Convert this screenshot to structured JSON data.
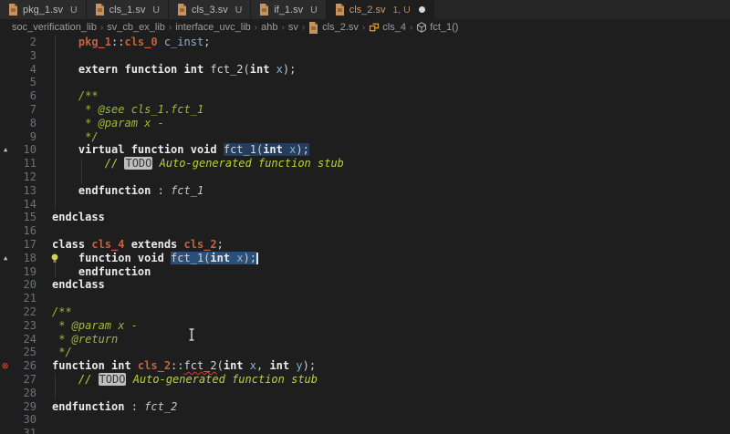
{
  "colors": {
    "editor_bg": "#1E1E1E",
    "active_tab_label": "#D79A63",
    "selection": "#2A4F78",
    "keyword": "#EAEAEA",
    "type_name": "#C4623F",
    "variable": "#8FB0D1",
    "comment": "#9FB83A",
    "error": "#CE4A33",
    "todo_bg": "#BFBFBF"
  },
  "tabs": [
    {
      "label": "pkg_1.sv",
      "suffix": "U",
      "active": false,
      "dirty": false
    },
    {
      "label": "cls_1.sv",
      "suffix": "U",
      "active": false,
      "dirty": false
    },
    {
      "label": "cls_3.sv",
      "suffix": "U",
      "active": false,
      "dirty": false
    },
    {
      "label": "if_1.sv",
      "suffix": "U",
      "active": false,
      "dirty": false
    },
    {
      "label": "cls_2.sv",
      "suffix": "1, U",
      "active": true,
      "dirty": true
    }
  ],
  "breadcrumb": {
    "items": [
      {
        "label": "soc_verification_lib"
      },
      {
        "label": "sv_cb_ex_lib"
      },
      {
        "label": "interface_uvc_lib"
      },
      {
        "label": "ahb"
      },
      {
        "label": "sv"
      },
      {
        "label": "cls_2.sv",
        "icon": "file"
      },
      {
        "label": "cls_4",
        "icon": "class"
      },
      {
        "label": "fct_1()",
        "icon": "method"
      }
    ]
  },
  "editor": {
    "lines": [
      {
        "n": 2,
        "g": 1,
        "t": [
          {
            "c": "ty",
            "x": "    pkg_1"
          },
          {
            "c": "pu",
            "x": "::"
          },
          {
            "c": "ty",
            "x": "cls_0"
          },
          {
            "c": "va",
            "x": " c_inst"
          },
          {
            "c": "pu",
            "x": ";"
          }
        ]
      },
      {
        "n": 3,
        "g": 1,
        "t": []
      },
      {
        "n": 4,
        "g": 1,
        "t": [
          {
            "c": "kw",
            "x": "    extern function int"
          },
          {
            "c": "id",
            "x": " fct_2"
          },
          {
            "c": "pu",
            "x": "("
          },
          {
            "c": "kw",
            "x": "int"
          },
          {
            "c": "va",
            "x": " x"
          },
          {
            "c": "pu",
            "x": ");"
          }
        ]
      },
      {
        "n": 5,
        "g": 1,
        "t": []
      },
      {
        "n": 6,
        "g": 1,
        "t": [
          {
            "c": "dc",
            "x": "    /**"
          }
        ]
      },
      {
        "n": 7,
        "g": 1,
        "t": [
          {
            "c": "dc",
            "x": "     * @see cls_1.fct_1"
          }
        ]
      },
      {
        "n": 8,
        "g": 1,
        "t": [
          {
            "c": "dc",
            "x": "     * @param x -"
          }
        ]
      },
      {
        "n": 9,
        "g": 1,
        "t": [
          {
            "c": "dc",
            "x": "     */"
          }
        ]
      },
      {
        "n": 10,
        "g": 1,
        "marker": "triangle",
        "t": [
          {
            "c": "kw",
            "x": "    virtual function void "
          },
          {
            "c": "se2",
            "t": [
              {
                "c": "id",
                "x": "fct_1"
              },
              {
                "c": "pu",
                "x": "("
              },
              {
                "c": "kw",
                "x": "int"
              },
              {
                "c": "va",
                "x": " x"
              },
              {
                "c": "pu",
                "x": ");"
              }
            ]
          }
        ]
      },
      {
        "n": 11,
        "g": 2,
        "t": [
          {
            "c": "cm",
            "x": "        // "
          },
          {
            "c": "td",
            "x": "TODO"
          },
          {
            "c": "cm",
            "x": " Auto-generated function stub"
          }
        ]
      },
      {
        "n": 12,
        "g": 2,
        "t": []
      },
      {
        "n": 13,
        "g": 1,
        "t": [
          {
            "c": "kw",
            "x": "    endfunction"
          },
          {
            "c": "pu",
            "x": " : "
          },
          {
            "c": "ii",
            "x": "fct_1"
          }
        ]
      },
      {
        "n": 14,
        "g": 1,
        "t": []
      },
      {
        "n": 15,
        "t": [
          {
            "c": "kw",
            "x": "endclass"
          }
        ]
      },
      {
        "n": 16,
        "t": []
      },
      {
        "n": 17,
        "t": [
          {
            "c": "kw",
            "x": "class "
          },
          {
            "c": "ty",
            "x": "cls_4"
          },
          {
            "c": "kw",
            "x": " extends "
          },
          {
            "c": "ty",
            "x": "cls_2"
          },
          {
            "c": "pu",
            "x": ";"
          }
        ]
      },
      {
        "n": 18,
        "g": 1,
        "marker": "triangle",
        "bulb": true,
        "t": [
          {
            "c": "kw",
            "x": "    function void "
          },
          {
            "c": "se",
            "t": [
              {
                "c": "id",
                "x": "fct_1"
              },
              {
                "c": "pu",
                "x": "("
              },
              {
                "c": "kw",
                "x": "int"
              },
              {
                "c": "va",
                "x": " x"
              },
              {
                "c": "pu",
                "x": ");"
              }
            ]
          },
          {
            "c": "ca"
          }
        ]
      },
      {
        "n": 19,
        "g": 1,
        "t": [
          {
            "c": "kw",
            "x": "    endfunction"
          }
        ]
      },
      {
        "n": 20,
        "t": [
          {
            "c": "kw",
            "x": "endclass"
          }
        ]
      },
      {
        "n": 21,
        "t": []
      },
      {
        "n": 22,
        "t": [
          {
            "c": "dc",
            "x": "/**"
          }
        ]
      },
      {
        "n": 23,
        "t": [
          {
            "c": "dc",
            "x": " * @param x -"
          }
        ]
      },
      {
        "n": 24,
        "t": [
          {
            "c": "dc",
            "x": " * @return"
          }
        ]
      },
      {
        "n": 25,
        "t": [
          {
            "c": "dc",
            "x": " */"
          }
        ]
      },
      {
        "n": 26,
        "marker": "error",
        "t": [
          {
            "c": "kw",
            "x": "function int "
          },
          {
            "c": "ty",
            "x": "cls_2"
          },
          {
            "c": "pu",
            "x": "::"
          },
          {
            "c": "id sq",
            "x": "fct_2"
          },
          {
            "c": "pu",
            "x": "("
          },
          {
            "c": "kw",
            "x": "int"
          },
          {
            "c": "va",
            "x": " x"
          },
          {
            "c": "pu",
            "x": ", "
          },
          {
            "c": "kw",
            "x": "int"
          },
          {
            "c": "va",
            "x": " y"
          },
          {
            "c": "pu",
            "x": ");"
          }
        ]
      },
      {
        "n": 27,
        "g": 1,
        "t": [
          {
            "c": "cm",
            "x": "    // "
          },
          {
            "c": "td",
            "x": "TODO"
          },
          {
            "c": "cm",
            "x": " Auto-generated function stub"
          }
        ]
      },
      {
        "n": 28,
        "g": 1,
        "t": []
      },
      {
        "n": 29,
        "t": [
          {
            "c": "kw",
            "x": "endfunction"
          },
          {
            "c": "pu",
            "x": " : "
          },
          {
            "c": "ii",
            "x": "fct_2"
          }
        ]
      },
      {
        "n": 30,
        "t": []
      },
      {
        "n": 31,
        "t": []
      }
    ]
  },
  "icons": {
    "gutter_marker": "triangle-up-icon",
    "error_glyph": "⊗",
    "triangle_glyph": "▲",
    "breadcrumb_separator": "›"
  }
}
